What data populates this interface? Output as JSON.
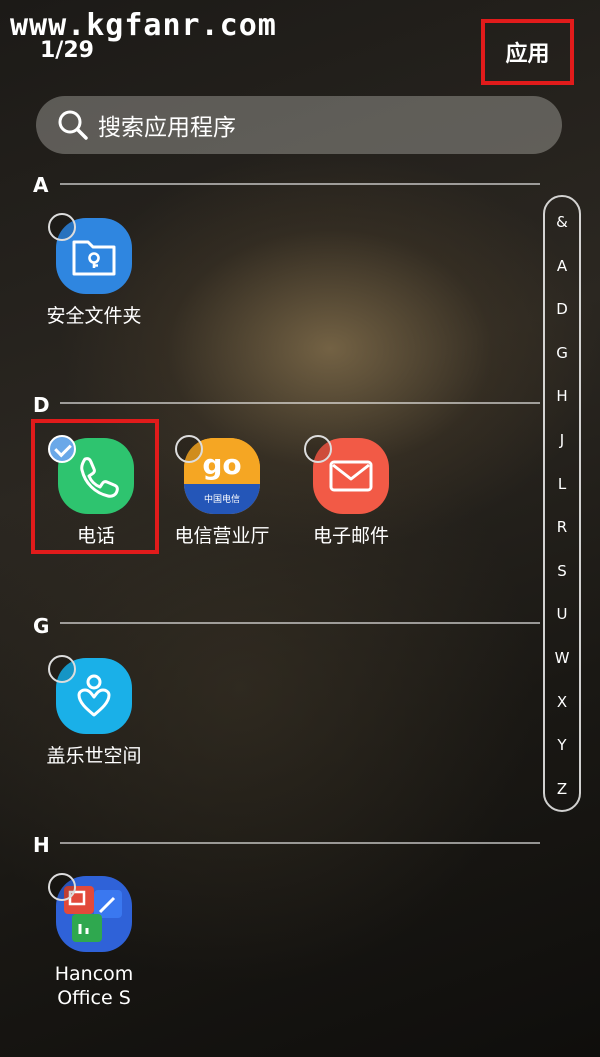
{
  "watermark": "www.kgfanr.com",
  "header": {
    "page_counter": "1/29",
    "apps_button": "应用"
  },
  "search": {
    "placeholder": "搜索应用程序"
  },
  "sections": [
    {
      "letter": "A",
      "apps": [
        {
          "label": "安全文件夹",
          "icon": "secure-folder-icon",
          "selected": false
        }
      ]
    },
    {
      "letter": "D",
      "apps": [
        {
          "label": "电话",
          "icon": "phone-icon",
          "selected": true
        },
        {
          "label": "电信营业厅",
          "icon": "telecom-icon",
          "selected": false
        },
        {
          "label": "电子邮件",
          "icon": "email-icon",
          "selected": false
        }
      ]
    },
    {
      "letter": "G",
      "apps": [
        {
          "label": "盖乐世空间",
          "icon": "galaxy-space-icon",
          "selected": false
        }
      ]
    },
    {
      "letter": "H",
      "apps": [
        {
          "label_line1": "Hancom",
          "label_line2": "Office S",
          "icon": "hancom-office-icon",
          "selected": false
        }
      ]
    }
  ],
  "telecom_tile_text": {
    "logo": "go",
    "brand": "中国电信"
  },
  "index_letters": [
    "&",
    "A",
    "D",
    "G",
    "H",
    "J",
    "L",
    "R",
    "S",
    "U",
    "W",
    "X",
    "Y",
    "Z"
  ],
  "colors": {
    "highlight_red": "#e11b1b",
    "secure_folder": "#2f86e0",
    "phone": "#2ec46f",
    "telecom": "#f0a020",
    "email": "#f25a46",
    "galaxy_space": "#1ab0e8",
    "hancom": "#2f62d8"
  }
}
